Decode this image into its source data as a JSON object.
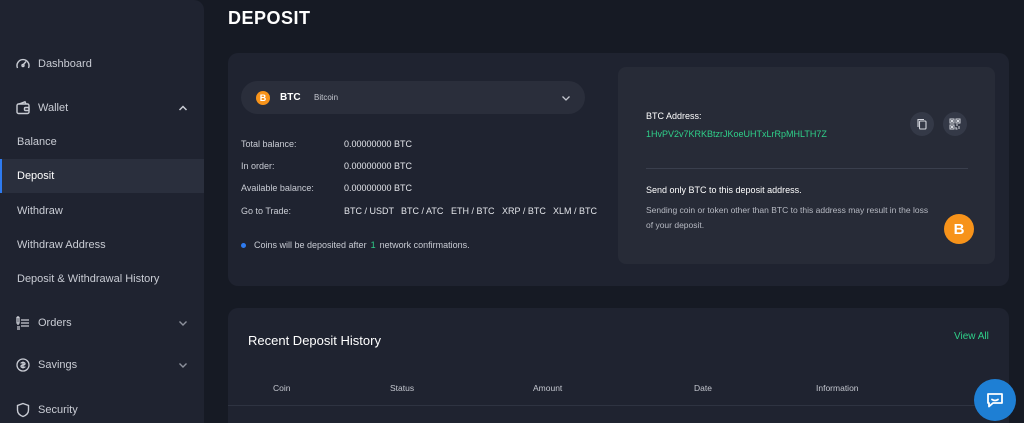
{
  "sidebar": {
    "items": [
      {
        "label": "Dashboard",
        "icon": "dashboard-icon"
      },
      {
        "label": "Wallet",
        "icon": "wallet-icon"
      },
      {
        "label": "Balance"
      },
      {
        "label": "Deposit"
      },
      {
        "label": "Withdraw"
      },
      {
        "label": "Withdraw Address"
      },
      {
        "label": "Deposit & Withdrawal History"
      },
      {
        "label": "Orders",
        "icon": "orders-icon"
      },
      {
        "label": "Savings",
        "icon": "savings-icon"
      },
      {
        "label": "Security",
        "icon": "shield-icon"
      }
    ],
    "active": "Deposit"
  },
  "page": {
    "title": "DEPOSIT"
  },
  "coin_select": {
    "symbol": "BTC",
    "name": "Bitcoin",
    "icon_glyph": "B"
  },
  "balances": [
    {
      "label": "Total balance:",
      "value": "0.00000000 BTC"
    },
    {
      "label": "In order:",
      "value": "0.00000000 BTC"
    },
    {
      "label": "Available balance:",
      "value": "0.00000000 BTC"
    }
  ],
  "trade": {
    "label": "Go to Trade:",
    "pairs": [
      "BTC / USDT",
      "BTC / ATC",
      "ETH / BTC",
      "XRP / BTC",
      "XLM / BTC"
    ]
  },
  "note": {
    "prefix": "Coins will be deposited after",
    "count": "1",
    "suffix": "network confirmations."
  },
  "address": {
    "label": "BTC Address:",
    "value": "1HvPV2v7KRKBtzrJKoeUHTxLrRpMHLTH7Z",
    "warning": "Send only BTC to this deposit address.",
    "description": "Sending coin or token other than BTC to this address may result in the loss of your deposit.",
    "badge_glyph": "B"
  },
  "history": {
    "title": "Recent Deposit History",
    "view_all": "View All",
    "columns": [
      "Coin",
      "Status",
      "Amount",
      "Date",
      "Information"
    ]
  },
  "colors": {
    "accent_blue": "#2e7bf0",
    "accent_green": "#2fd08a",
    "btc_orange": "#f7931a"
  }
}
